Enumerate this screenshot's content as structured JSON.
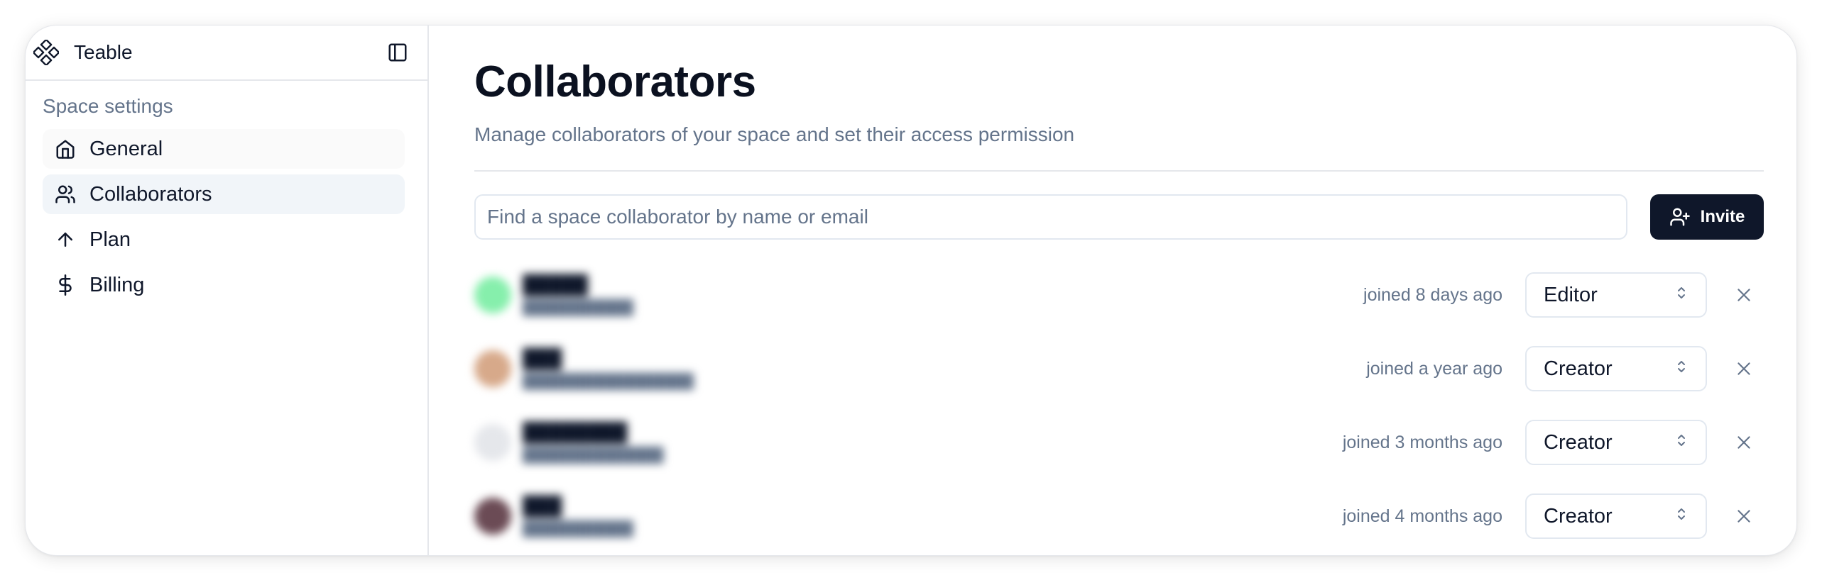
{
  "sidebar": {
    "brand": "Teable",
    "section_title": "Space settings",
    "items": [
      {
        "label": "General",
        "icon": "home-icon"
      },
      {
        "label": "Collaborators",
        "icon": "users-icon",
        "active": true
      },
      {
        "label": "Plan",
        "icon": "arrow-up-icon"
      },
      {
        "label": "Billing",
        "icon": "dollar-icon"
      }
    ]
  },
  "main": {
    "title": "Collaborators",
    "description": "Manage collaborators of your space and set their access permission",
    "search": {
      "placeholder": "Find a space collaborator by name or email",
      "value": ""
    },
    "invite_label": "Invite"
  },
  "members": [
    {
      "joined": "joined 8 days ago",
      "role": "Editor",
      "avatar_color": "#86efac"
    },
    {
      "joined": "joined a year ago",
      "role": "Creator",
      "avatar_color": "#d7a98a"
    },
    {
      "joined": "joined 3 months ago",
      "role": "Creator",
      "avatar_color": "#e5e7eb"
    },
    {
      "joined": "joined 4 months ago",
      "role": "Creator",
      "avatar_color": "#6b4b55"
    }
  ],
  "colors": {
    "primary": "#0f172a",
    "muted_text": "#64748b",
    "border": "#e5e7eb",
    "active_bg": "#f1f5f9"
  }
}
